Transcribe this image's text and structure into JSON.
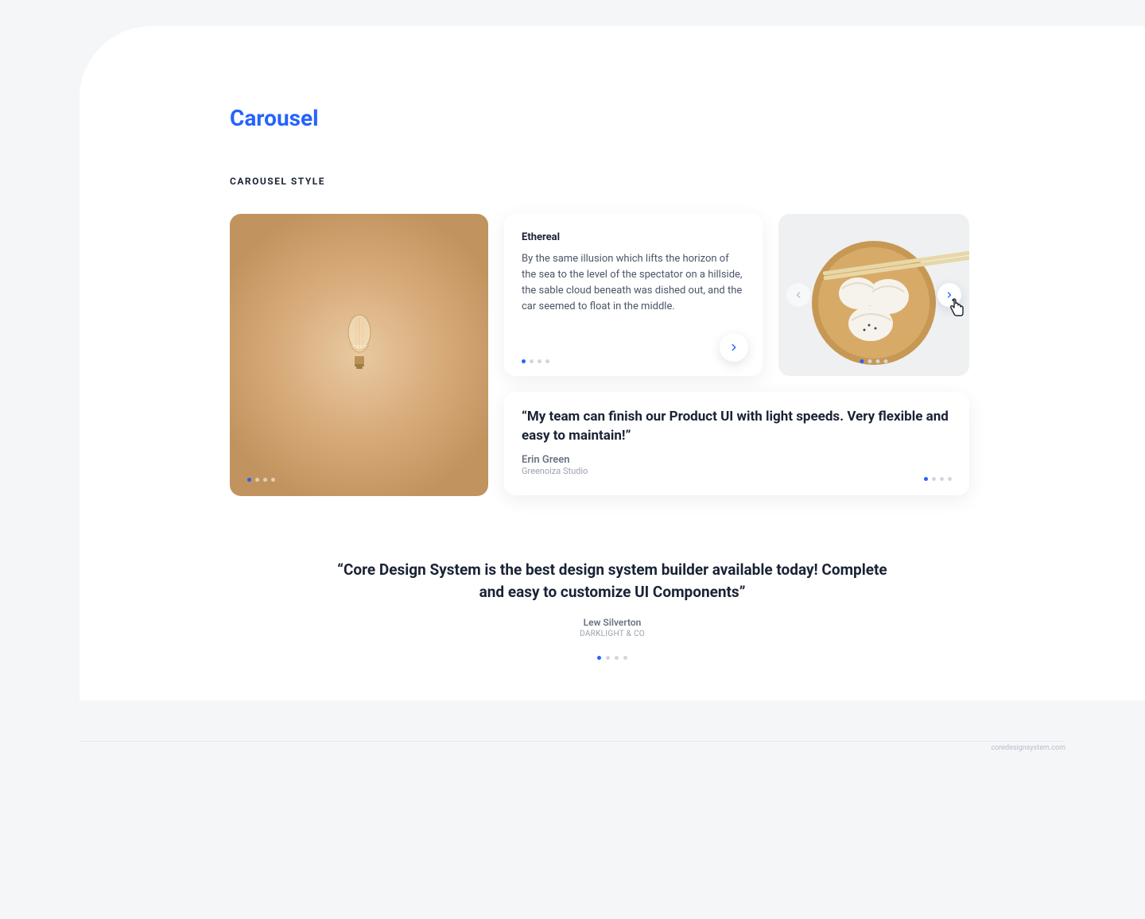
{
  "page_title": "Carousel",
  "section_label": "CAROUSEL STYLE",
  "ethereal_card": {
    "title": "Ethereal",
    "body": "By the same illusion which lifts the horizon of the sea to the level of the spectator on a hillside, the sable cloud beneath was dished out, and the car seemed to float in the middle."
  },
  "testimonial_wide": {
    "quote": "“My team can finish our Product UI with light speeds. Very flexible and easy to maintain!”",
    "author": "Erin Green",
    "studio": "Greenoiza Studio"
  },
  "testimonial_big": {
    "quote": "“Core Design System is the best design system builder available today! Complete and easy to customize UI Components”",
    "author": "Lew Silverton",
    "company": "DARKLIGHT & CO"
  },
  "footer": "coredesignsystem.com"
}
